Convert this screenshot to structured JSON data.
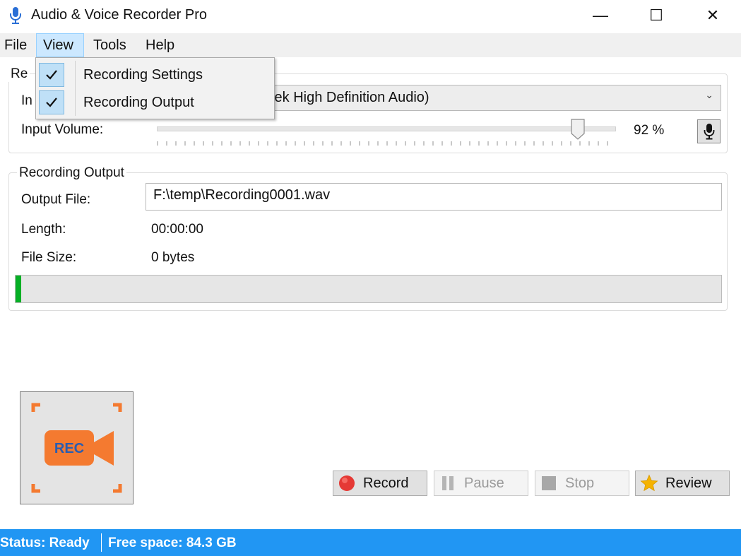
{
  "window": {
    "title": "Audio & Voice Recorder Pro",
    "controls": {
      "minimize": "—",
      "maximize": "☐",
      "close": "✕"
    }
  },
  "menu": {
    "items": [
      "File",
      "View",
      "Tools",
      "Help"
    ],
    "open_menu": "View",
    "dropdown": [
      {
        "label": "Recording Settings",
        "checked": true
      },
      {
        "label": "Recording Output",
        "checked": true
      }
    ]
  },
  "recording_settings": {
    "title_partial": "Re",
    "input_label_partial": "In",
    "input_device_visible": "tek High Definition Audio)",
    "volume_label": "Input Volume:",
    "volume_display": "92 %",
    "volume_level": 0.92
  },
  "recording_output": {
    "title": "Recording Output",
    "output_file_label": "Output File:",
    "output_file": "F:\\temp\\Recording0001.wav",
    "length_label": "Length:",
    "length": "00:00:00",
    "file_size_label": "File Size:",
    "file_size": "0 bytes",
    "progress": 0.008
  },
  "buttons": {
    "record": "Record",
    "pause": "Pause",
    "stop": "Stop",
    "review": "Review"
  },
  "rec_logo": {
    "text": "REC"
  },
  "status": {
    "state": "Status: Ready",
    "free_space": "Free space: 84.3 GB"
  },
  "colors": {
    "status_bar": "#2196f3",
    "progress": "#06b025",
    "rec_orange": "#f47a30",
    "rec_text": "#2a5db0",
    "record_red": "#e53935",
    "review_star": "#f5b301"
  }
}
